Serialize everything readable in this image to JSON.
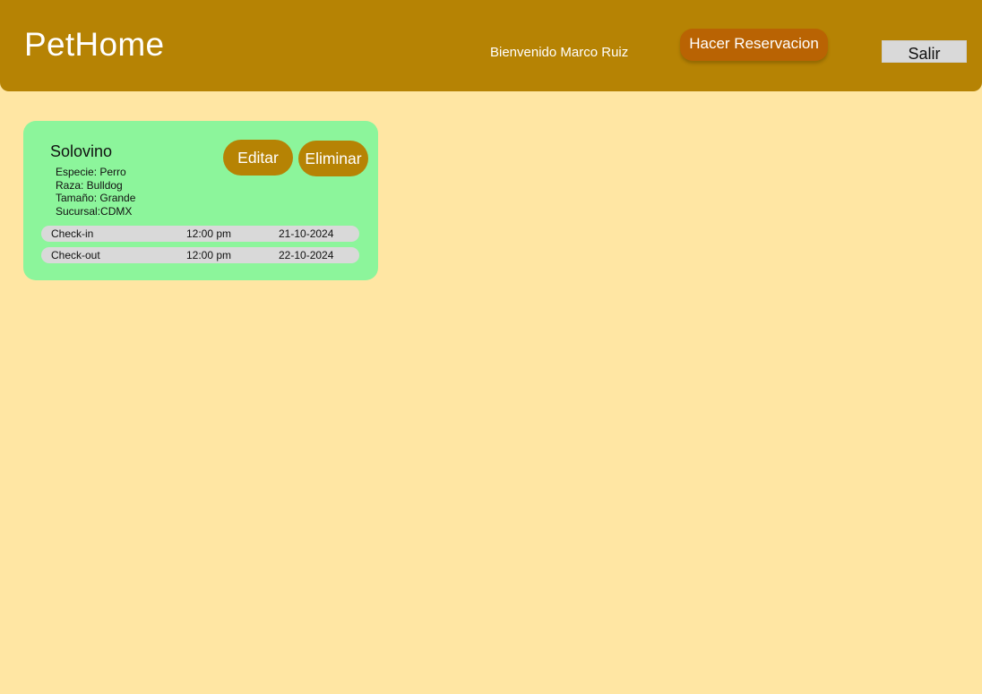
{
  "header": {
    "logo": "PetHome",
    "welcome": "Bienvenido Marco Ruiz",
    "reserve_label": "Hacer Reservacion",
    "logout_label": "Salir"
  },
  "colors": {
    "background": "#FFE6A3",
    "header": "#B68304",
    "reserve_button": "#B96303",
    "card": "#8CF59B",
    "card_button": "#B68304",
    "row": "#D9D9D9",
    "logout_button": "#D9D9D9"
  },
  "pets": [
    {
      "name": "Solovino",
      "details": {
        "species": "Especie: Perro",
        "breed": "Raza: Bulldog",
        "size": "Tamaño: Grande",
        "branch": "Sucursal:CDMX"
      },
      "edit_label": "Editar",
      "delete_label": "Eliminar",
      "schedule": [
        {
          "label": "Check-in",
          "time": "12:00 pm",
          "date": "21-10-2024"
        },
        {
          "label": "Check-out",
          "time": "12:00 pm",
          "date": "22-10-2024"
        }
      ]
    }
  ]
}
